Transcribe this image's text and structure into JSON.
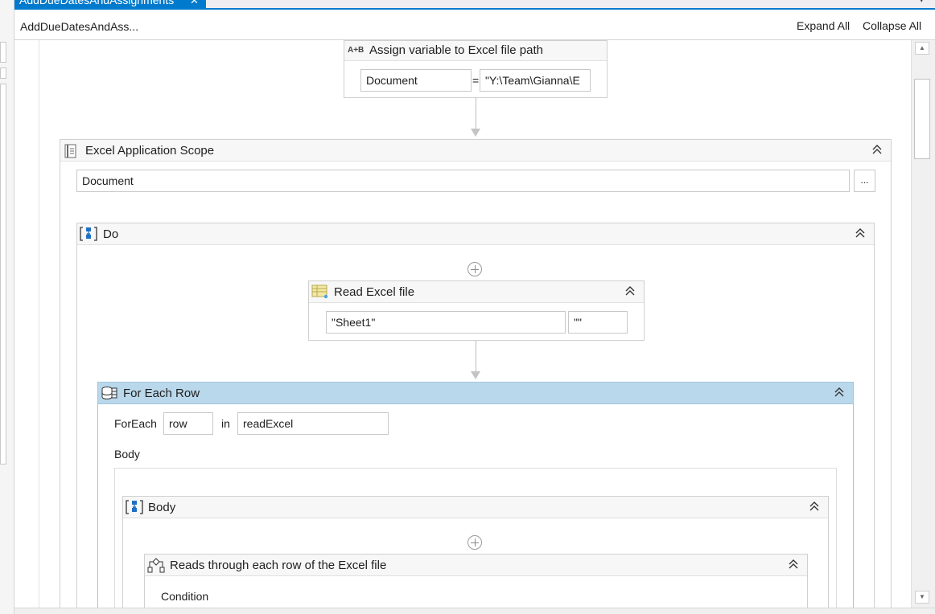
{
  "tab": {
    "label": "AddDueDatesAndAssignments",
    "close_glyph": "✕"
  },
  "breadcrumb": {
    "label": "AddDueDatesAndAss..."
  },
  "toolbar": {
    "expand_all": "Expand All",
    "collapse_all": "Collapse All"
  },
  "assign": {
    "icon_text": "A+B",
    "title": "Assign variable to Excel file path",
    "left": "Document",
    "equals": "=",
    "right": "\"Y:\\Team\\Gianna\\E"
  },
  "excel_scope": {
    "title": "Excel Application Scope",
    "path": "Document",
    "browse": "..."
  },
  "do_seq": {
    "title": "Do"
  },
  "read_excel": {
    "title": "Read Excel file",
    "sheet": "\"Sheet1\"",
    "range": "\"\""
  },
  "for_each": {
    "title": "For Each Row",
    "foreach_label": "ForEach",
    "item": "row",
    "in_label": "in",
    "collection": "readExcel",
    "body_label": "Body"
  },
  "body_seq": {
    "title": "Body"
  },
  "condition_activity": {
    "title": "Reads through each row of the Excel file",
    "condition_label": "Condition"
  },
  "colors": {
    "accent": "#007acc",
    "foreach_header": "#bad8eb",
    "icon_blue": "#1f6fc5"
  }
}
